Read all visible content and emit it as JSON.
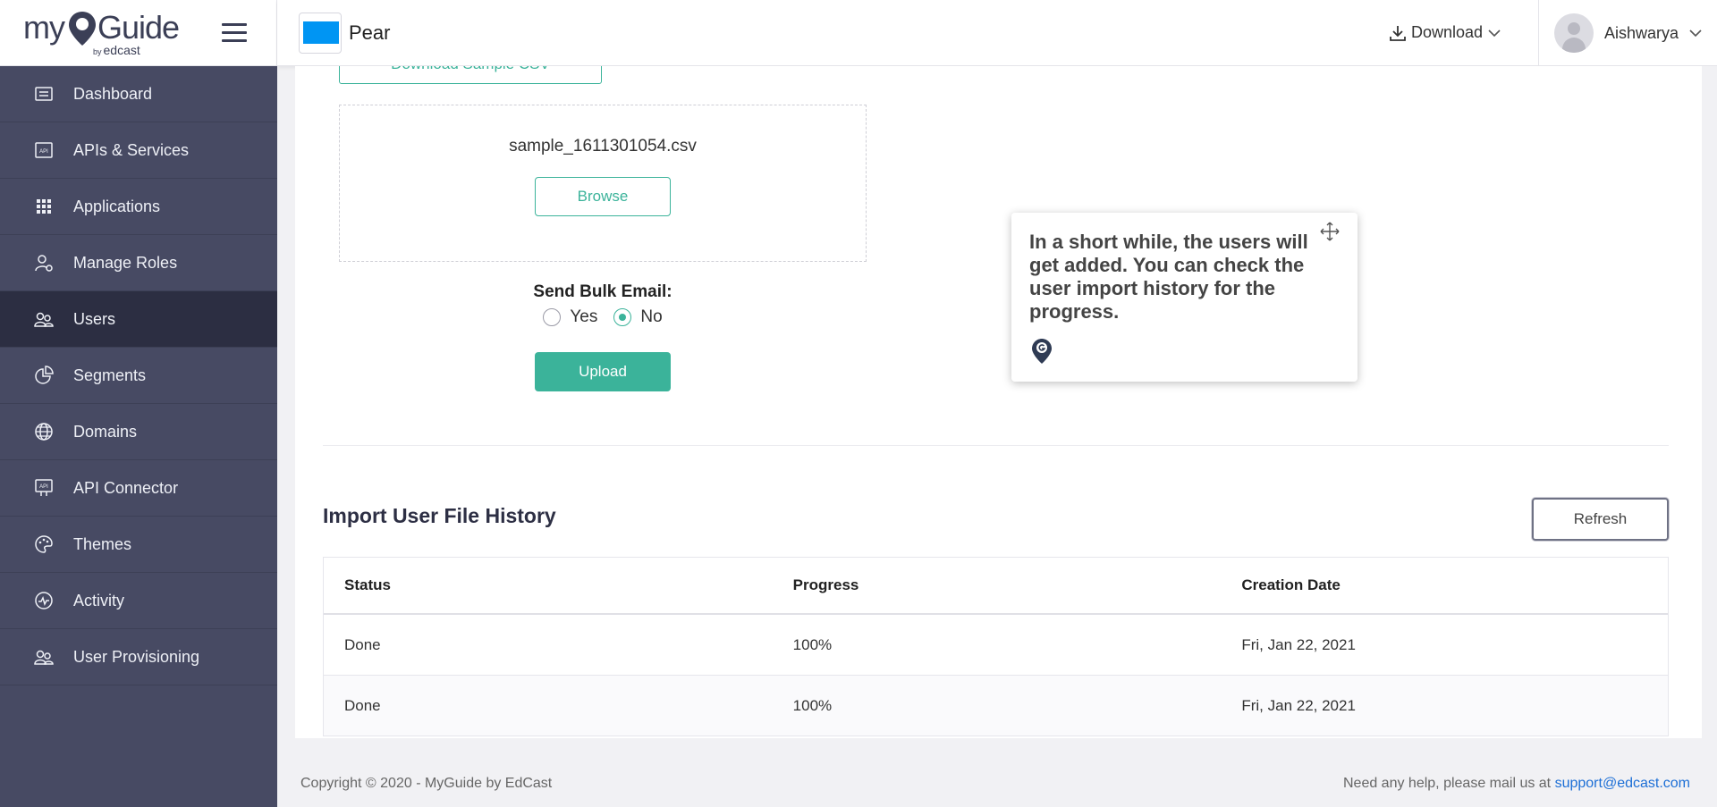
{
  "brand": {
    "logo_my": "my",
    "logo_guide": "Guide",
    "logo_by": "by",
    "logo_edcast": "edcast"
  },
  "header": {
    "app_name": "Pear",
    "app_color": "#0095f3",
    "download_label": "Download",
    "user_name": "Aishwarya"
  },
  "sidebar": {
    "items": [
      {
        "label": "Dashboard",
        "icon": "dashboard-icon"
      },
      {
        "label": "APIs & Services",
        "icon": "api-icon"
      },
      {
        "label": "Applications",
        "icon": "grid-icon"
      },
      {
        "label": "Manage Roles",
        "icon": "role-icon"
      },
      {
        "label": "Users",
        "icon": "users-icon",
        "active": true
      },
      {
        "label": "Segments",
        "icon": "pie-icon"
      },
      {
        "label": "Domains",
        "icon": "globe-icon"
      },
      {
        "label": "API Connector",
        "icon": "api-connector-icon"
      },
      {
        "label": "Themes",
        "icon": "palette-icon"
      },
      {
        "label": "Activity",
        "icon": "activity-icon"
      },
      {
        "label": "User Provisioning",
        "icon": "user-provisioning-icon"
      }
    ]
  },
  "upload": {
    "sample_csv_label": "Download Sample CSV",
    "file_name": "sample_1611301054.csv",
    "browse_label": "Browse",
    "bulk_email_label": "Send Bulk Email:",
    "yes_label": "Yes",
    "no_label": "No",
    "selected": "No",
    "upload_label": "Upload"
  },
  "history": {
    "title": "Import User File History",
    "refresh_label": "Refresh",
    "columns": [
      "Status",
      "Progress",
      "Creation Date"
    ],
    "rows": [
      {
        "status": "Done",
        "progress": "100%",
        "date": "Fri, Jan 22, 2021"
      },
      {
        "status": "Done",
        "progress": "100%",
        "date": "Fri, Jan 22, 2021"
      }
    ]
  },
  "tooltip": {
    "text": "In a short while, the users will get added. You can check the user import history for the progress."
  },
  "footer": {
    "copyright": "Copyright © 2020 - MyGuide by EdCast",
    "help_text": "Need any help, please mail us at ",
    "help_email": "support@edcast.com"
  },
  "colors": {
    "accent": "#3bb39a",
    "sidebar_bg": "#474a63",
    "sidebar_active": "#2c2e42",
    "link": "#1d6fd6"
  }
}
